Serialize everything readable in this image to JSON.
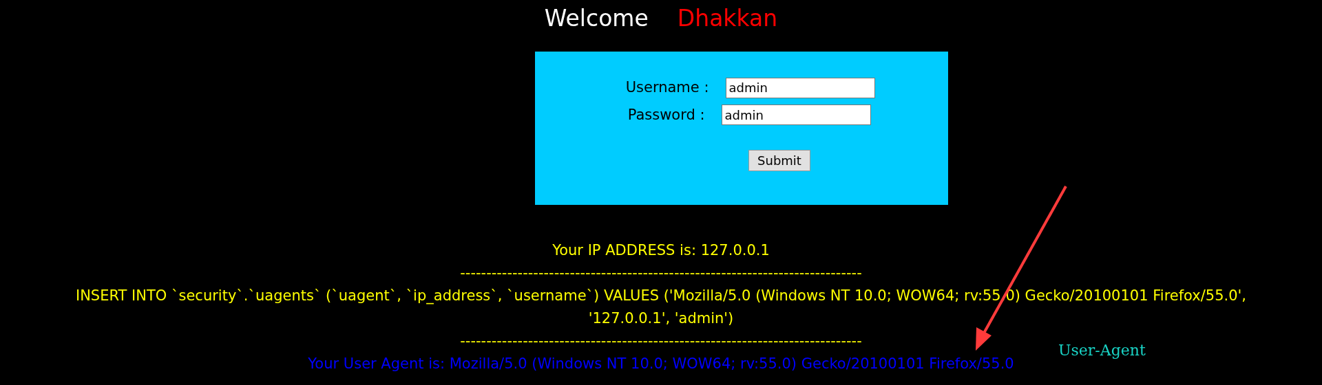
{
  "heading": {
    "greeting": "Welcome",
    "name": "Dhakkan"
  },
  "login_form": {
    "fields": [
      {
        "label": "Username :",
        "value": "admin"
      },
      {
        "label": "Password :",
        "value": "admin"
      }
    ],
    "submit": "Submit"
  },
  "output": {
    "ip_line": "Your IP ADDRESS is: 127.0.0.1",
    "separator_top": "-----------------------------------------------------------------------------",
    "query": "INSERT INTO `security`.`uagents` (`uagent`, `ip_address`, `username`) VALUES ('Mozilla/5.0 (Windows NT 10.0; WOW64; rv:55.0) Gecko/20100101 Firefox/55.0', '127.0.0.1', 'admin')",
    "separator_bottom": "-----------------------------------------------------------------------------",
    "user_agent_line": "Your User Agent is: Mozilla/5.0 (Windows NT 10.0; WOW64; rv:55.0) Gecko/20100101 Firefox/55.0"
  },
  "annotation": {
    "label": "User-Agent"
  }
}
